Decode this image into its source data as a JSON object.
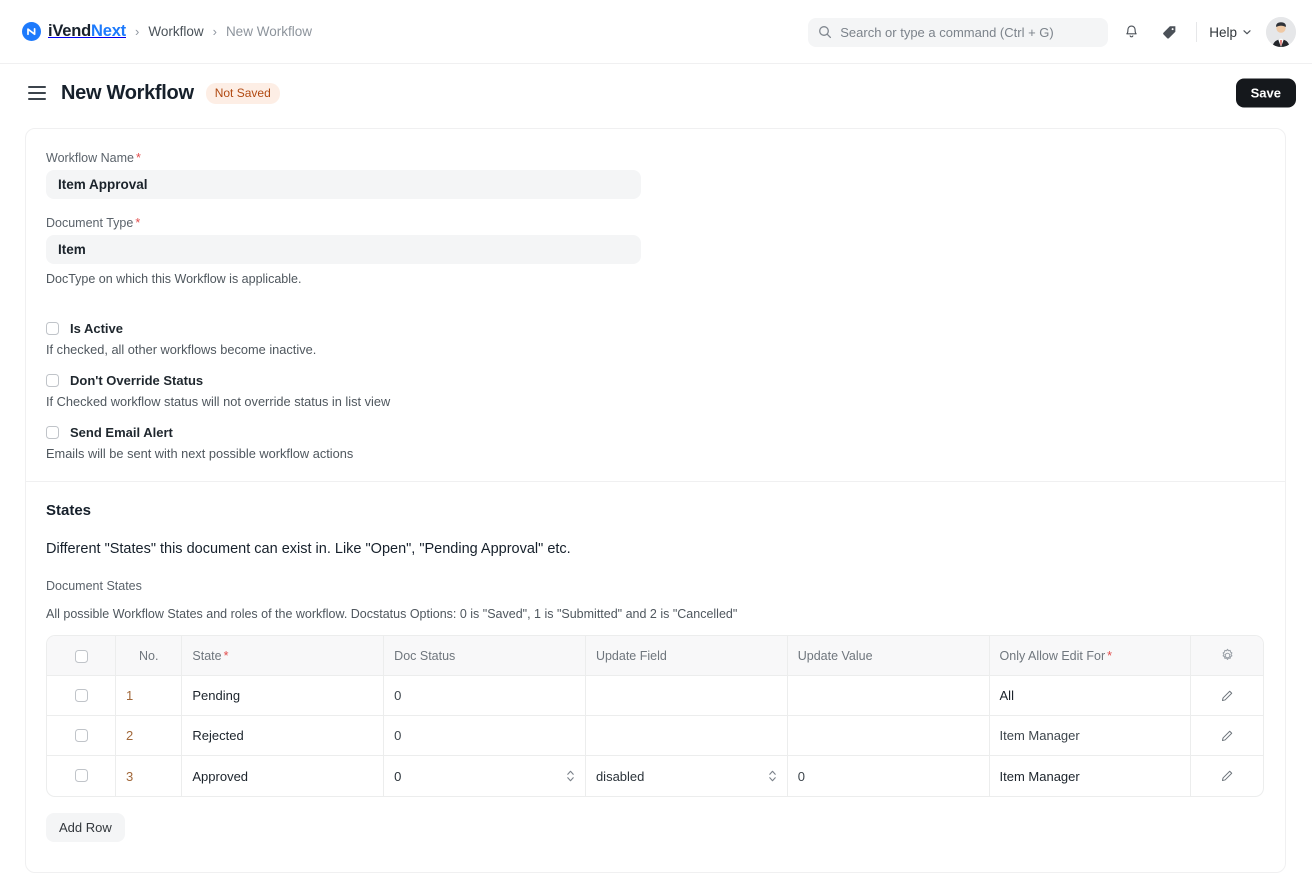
{
  "navbar": {
    "brand": {
      "part1": "iVend",
      "part2": "Next",
      "mark": "monogram-icon"
    },
    "breadcrumb": [
      {
        "label": "Workflow",
        "current": false
      },
      {
        "label": "New Workflow",
        "current": true
      }
    ],
    "separator": "›",
    "search": {
      "placeholder": "Search or type a command (Ctrl + G)",
      "value": "",
      "icon": "search-icon"
    },
    "notifications_icon": "bell-icon",
    "tag_icon": "tag-icon",
    "help": {
      "label": "Help",
      "caret": "chevron-down-icon"
    },
    "avatar": "user-avatar"
  },
  "page_head": {
    "menu_icon": "hamburger-icon",
    "title": "New Workflow",
    "status_badge": "Not Saved",
    "save_label": "Save"
  },
  "form": {
    "workflow_name": {
      "label": "Workflow Name",
      "required": "*",
      "value": "Item Approval"
    },
    "document_type": {
      "label": "Document Type",
      "required": "*",
      "value": "Item",
      "description": "DocType on which this Workflow is applicable."
    },
    "checkboxes": [
      {
        "label": "Is Active",
        "checked": false,
        "description": "If checked, all other workflows become inactive."
      },
      {
        "label": "Don't Override Status",
        "checked": false,
        "description": "If Checked workflow status will not override status in list view"
      },
      {
        "label": "Send Email Alert",
        "checked": false,
        "description": "Emails will be sent with next possible workflow actions"
      }
    ]
  },
  "states": {
    "section_title": "States",
    "section_subtitle": "Different \"States\" this document can exist in. Like \"Open\", \"Pending Approval\" etc.",
    "grid_label": "Document States",
    "grid_description": "All possible Workflow States and roles of the workflow. Docstatus Options: 0 is \"Saved\", 1 is \"Submitted\" and 2 is \"Cancelled\"",
    "columns": [
      {
        "key": "check",
        "label": "",
        "required": ""
      },
      {
        "key": "no",
        "label": "No.",
        "required": ""
      },
      {
        "key": "state",
        "label": "State",
        "required": "*"
      },
      {
        "key": "doc_status",
        "label": "Doc Status",
        "required": ""
      },
      {
        "key": "update_field",
        "label": "Update Field",
        "required": ""
      },
      {
        "key": "update_value",
        "label": "Update Value",
        "required": ""
      },
      {
        "key": "only_allow_edit_for",
        "label": "Only Allow Edit For",
        "required": "*"
      },
      {
        "key": "settings",
        "label": "",
        "required": ""
      }
    ],
    "settings_icon": "gear-icon",
    "edit_icon": "pencil-icon",
    "rows": [
      {
        "no": "1",
        "state": "Pending",
        "doc_status": "0",
        "update_field": "",
        "update_value": "",
        "only_allow_edit_for": "All",
        "active": false
      },
      {
        "no": "2",
        "state": "Rejected",
        "doc_status": "0",
        "update_field": "",
        "update_value": "",
        "only_allow_edit_for": "Item Manager",
        "active": false
      },
      {
        "no": "3",
        "state": "Approved",
        "doc_status": "0",
        "update_field": "disabled",
        "update_value": "0",
        "only_allow_edit_for": "Item Manager",
        "active": true
      }
    ],
    "add_row_label": "Add Row"
  },
  "colors": {
    "brand_blue": "#1d7afc",
    "badge_bg": "#fdeee5",
    "badge_text": "#b14a12",
    "save_bg": "#15181c",
    "required_red": "#e24c4c",
    "row_number": "#a2683a"
  }
}
